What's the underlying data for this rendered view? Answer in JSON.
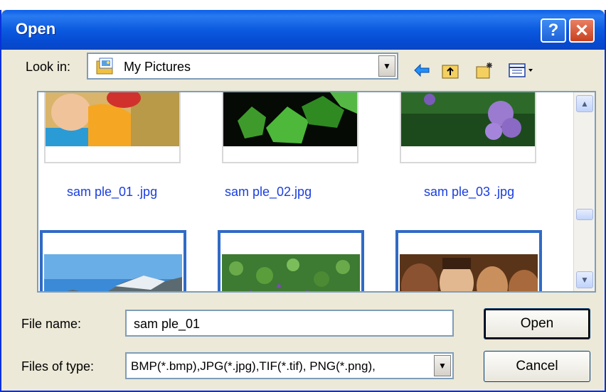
{
  "window": {
    "title": "Open",
    "help_glyph": "?",
    "close_glyph": "✕"
  },
  "lookin": {
    "label": "Look in:",
    "value": "My Pictures",
    "icons": [
      "my-pictures-folder-icon",
      "back-arrow-icon",
      "up-one-level-icon",
      "new-folder-icon",
      "view-menu-icon"
    ]
  },
  "files": [
    {
      "name": "sam ple_01 .jpg",
      "selected": false
    },
    {
      "name": "sam ple_02.jpg",
      "selected": false
    },
    {
      "name": "sam ple_03 .jpg",
      "selected": false
    },
    {
      "name": "",
      "selected": true
    },
    {
      "name": "",
      "selected": true
    },
    {
      "name": "",
      "selected": true
    }
  ],
  "form": {
    "file_name_label": "File name:",
    "file_name_value": "sam ple_01",
    "file_type_label": "Files of type:",
    "file_type_value": "BMP(*.bmp),JPG(*.jpg),TIF(*.tif), PNG(*.png),"
  },
  "buttons": {
    "open": "Open",
    "cancel": "Cancel"
  },
  "colors": {
    "title_bar": "#0a5fe8",
    "caption": "#1a3ee0",
    "selection": "#316ac5"
  }
}
